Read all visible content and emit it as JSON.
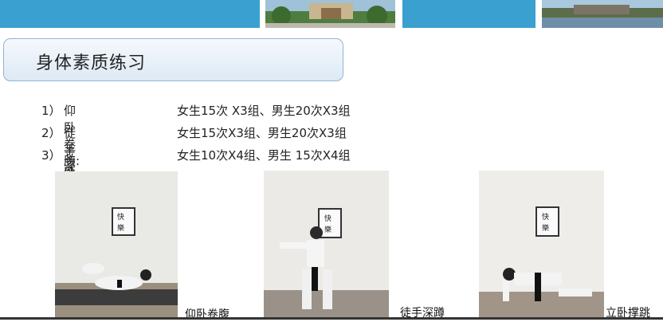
{
  "title": "身体素质练习",
  "exercises": [
    {
      "num": "1）",
      "name": "仰卧卷腹:",
      "spec": "女生15次 X3组、男生20次X3组"
    },
    {
      "num": "2）",
      "name": "徒手深蹲:",
      "spec": "女生15次X3组、男生20次X3组"
    },
    {
      "num": "3）",
      "name": "立卧撑跳:",
      "spec": "女生10次X4组、男生 15次X4组"
    }
  ],
  "captions": [
    "仰卧卷腹",
    "徒手深蹲",
    "立卧撑跳"
  ],
  "colors": {
    "banner_blue": "#3aa0cf",
    "title_border": "#8fb5d6"
  }
}
